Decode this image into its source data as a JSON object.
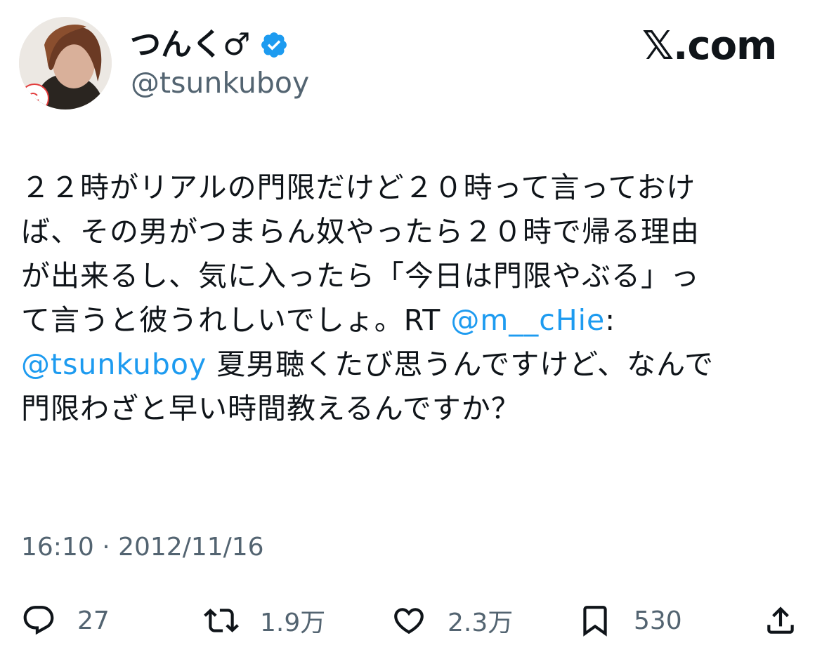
{
  "header": {
    "display_name": "つんく♂",
    "handle": "@tsunkuboy",
    "site": "𝕏.com"
  },
  "tweet": {
    "lines": [
      [
        {
          "t": "２２時がリアルの門限だけど２０時って言っておけ"
        }
      ],
      [
        {
          "t": "ば、その男がつまらん奴やったら２０時で帰る理由"
        }
      ],
      [
        {
          "t": "が出来るし、気に入ったら「今日は門限やぶる」っ"
        }
      ],
      [
        {
          "t": "て言うと彼うれしいでしょ。RT "
        },
        {
          "t": "@m__cHie",
          "mention": true
        },
        {
          "t": ":"
        }
      ],
      [
        {
          "t": "@tsunkuboy",
          "mention": true
        },
        {
          "t": " 夏男聴くたび思うんですけど、なんで"
        }
      ],
      [
        {
          "t": "門限わざと早い時間教えるんですか？"
        }
      ]
    ],
    "timestamp": "16:10 · 2012/11/16"
  },
  "actions": {
    "replies": "27",
    "retweets": "1.9万",
    "likes": "2.3万",
    "bookmarks": "530"
  },
  "colors": {
    "link": "#1d9bf0",
    "verified": "#1d9bf0",
    "muted": "#536471"
  }
}
